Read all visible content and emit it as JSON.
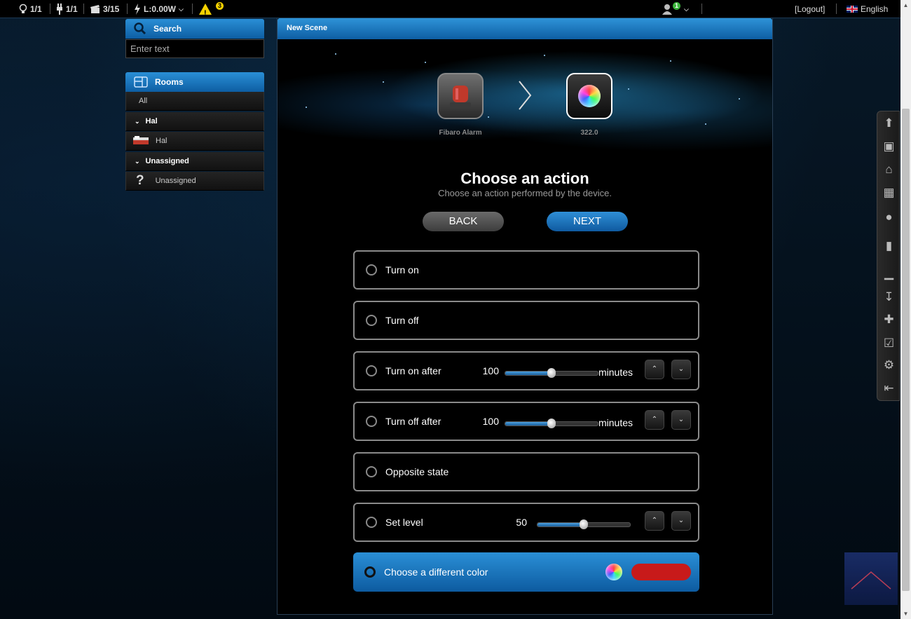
{
  "topbar": {
    "lights": "1/1",
    "plugs": "1/1",
    "scenes": "3/15",
    "power": "L:0.00W",
    "alerts_count": "3",
    "user_notifications": "1",
    "logout": "[Logout]",
    "language": "English"
  },
  "sidebar": {
    "search": {
      "title": "Search",
      "placeholder": "Enter text"
    },
    "rooms": {
      "title": "Rooms",
      "items": [
        {
          "label": "All",
          "type": "filter"
        },
        {
          "label": "Hal",
          "type": "group"
        },
        {
          "label": "Hal",
          "type": "room",
          "icon": "bed-icon"
        },
        {
          "label": "Unassigned",
          "type": "group"
        },
        {
          "label": "Unassigned",
          "type": "room",
          "icon": "question-icon"
        }
      ]
    }
  },
  "main": {
    "title": "New Scene",
    "devices": [
      {
        "label": "Fibaro Alarm",
        "icon": "siren-icon"
      },
      {
        "label": "322.0",
        "icon": "color-wheel-icon"
      }
    ],
    "heading": "Choose an action",
    "subheading": "Choose an action performed by the device.",
    "back_label": "BACK",
    "next_label": "NEXT",
    "options": [
      {
        "label": "Turn on"
      },
      {
        "label": "Turn off"
      },
      {
        "label": "Turn on after",
        "value": "100",
        "unit": "minutes",
        "level": 0.5
      },
      {
        "label": "Turn off after",
        "value": "100",
        "unit": "minutes",
        "level": 0.5
      },
      {
        "label": "Opposite state"
      },
      {
        "label": "Set level",
        "value": "50",
        "level": 0.5
      },
      {
        "label": "Choose a different color",
        "selected": true,
        "color": "#c81a1a"
      }
    ]
  },
  "colors": {
    "accent": "#1a74c0",
    "swatch": "#c81a1a",
    "warning": "#f5d100"
  }
}
